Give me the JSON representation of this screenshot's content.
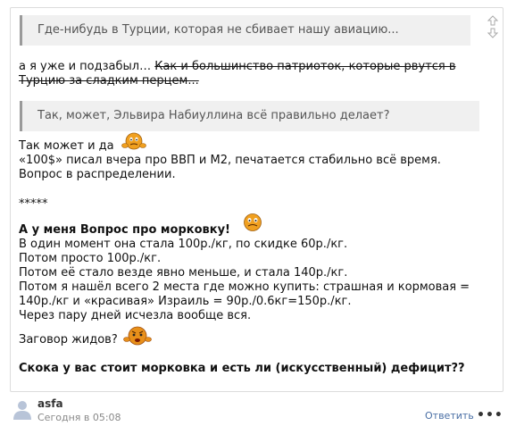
{
  "post": {
    "quote1": "Где-нибудь в Турции, которая не сбивает нашу авиацию...",
    "line_forgot_plain": "а я уже и подзабыл… ",
    "line_forgot_strike_1": "Как и большинство патриоток, которые рвутся в",
    "line_forgot_strike_2": "Турцию за сладким перцем...",
    "quote2": "Так, может, Эльвира Набиуллина всё правильно делает?",
    "line_maybe": "Так может и да",
    "line_100": "«100$» писал вчера про ВВП и М2, печатается стабильно всё время.",
    "line_question_distribution": "Вопрос в распределении.",
    "separator": "*****",
    "heading_carrot": "А у меня Вопрос про морковку!",
    "line_1": "В один момент она стала 100р./кг, по скидке 60р./кг.",
    "line_2": "Потом просто 100р./кг.",
    "line_3": "Потом её стало везде явно меньше, и стала 140р./кг.",
    "line_4a": "Потом я нашёл всего 2 места где можно купить: страшная и кормовая =",
    "line_4b": "140р./кг и «красивая» Израиль = 90р./0.6кг=150р./кг.",
    "line_5": "Через пару дней исчезла вообще вся.",
    "line_conspiracy": "Заговор жидов?",
    "line_final": "Скока у вас стоит морковка и есть ли (искусственный) дефицит??"
  },
  "footer": {
    "username": "asfa",
    "timestamp": "Сегодня в 05:08",
    "reply_label": "Ответить",
    "more_label": "•••"
  },
  "icons": {
    "scroll_up": "arrow-up-icon",
    "scroll_down": "arrow-down-icon",
    "smiley_1": "confused-smiley-icon",
    "smiley_2": "confused-smiley-icon",
    "smiley_3": "angry-smiley-icon",
    "avatar": "user-avatar-icon"
  },
  "colors": {
    "quote_bg": "#f0f0f0",
    "quote_border": "#9a9a9a",
    "link": "#4a6fa5",
    "smiley": "#f0a020"
  }
}
